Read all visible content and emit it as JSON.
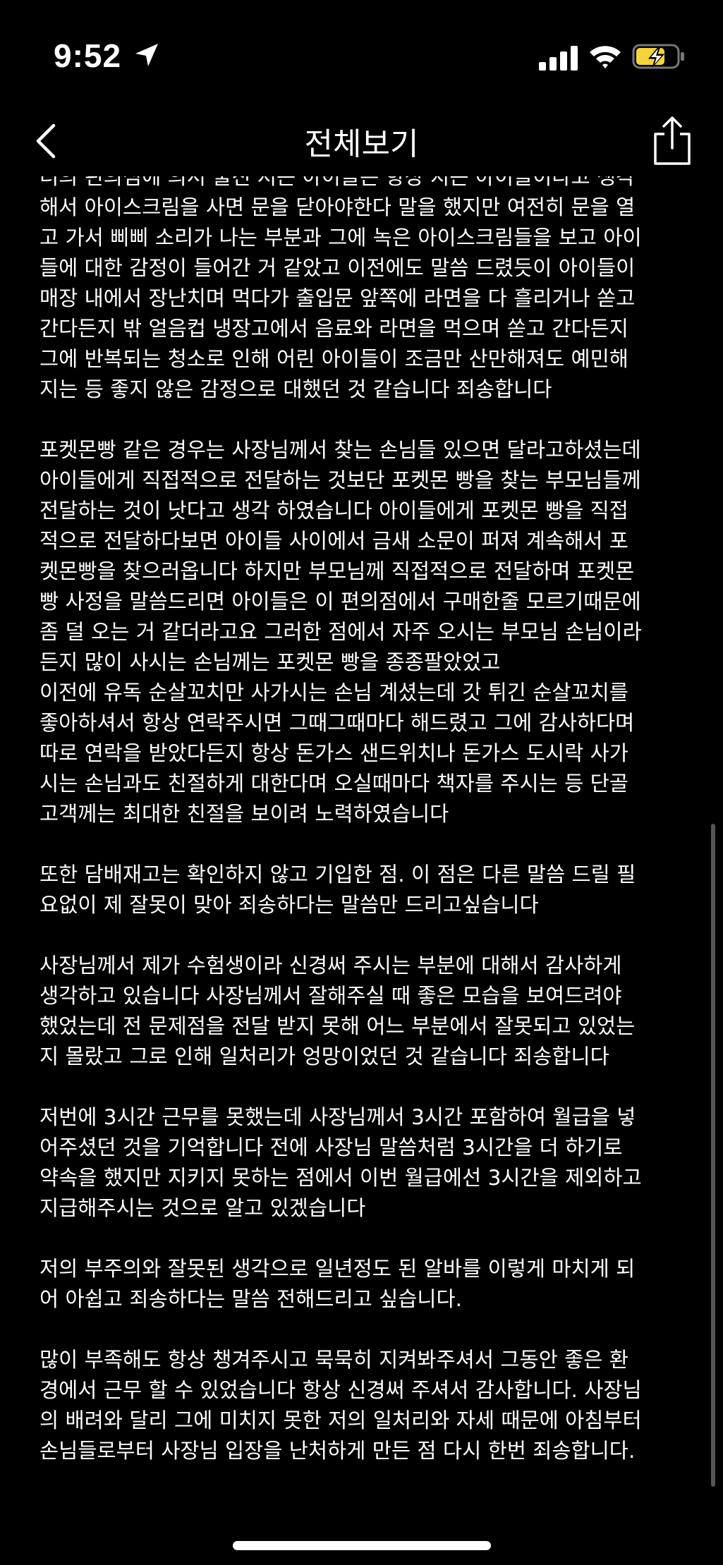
{
  "status_bar": {
    "time": "9:52",
    "icons": [
      "location-arrow-icon",
      "cellular-signal-icon",
      "wifi-icon",
      "battery-charging-icon"
    ],
    "battery_color": "#f5d33b"
  },
  "nav": {
    "title": "전체보기",
    "back_icon": "chevron-left-icon",
    "share_icon": "share-icon"
  },
  "paragraphs": [
    {
      "lines": [
        "더의 핀의심에 의서 물진 저는 아이들은 항상 지는 아이들이다고 생각",
        "해서 아이스크림을 사면 문을 닫아야한다 말을 했지만 여전히 문을 열",
        "고 가서 삐삐 소리가 나는 부분과 그에 녹은 아이스크림들을 보고 아이",
        "들에 대한 감정이 들어간 거 같았고 이전에도 말씀 드렸듯이 아이들이",
        "매장 내에서 장난치며 먹다가 출입문 앞쪽에 라면을 다 흘리거나 쏟고",
        "간다든지 밖 얼음컵 냉장고에서 음료와 라면을 먹으며 쏟고 간다든지",
        "그에 반복되는 청소로 인해 어린 아이들이 조금만 산만해져도 예민해",
        "지는 등 좋지 않은 감정으로 대했던 것 같습니다 죄송합니다"
      ]
    },
    {
      "lines": [
        "포켓몬빵 같은 경우는 사장님께서 찾는 손님들 있으면 달라고하셨는데",
        "아이들에게 직접적으로 전달하는 것보단 포켓몬 빵을 찾는 부모님들께",
        "전달하는 것이 낫다고 생각 하였습니다 아이들에게 포켓몬 빵을 직접",
        "적으로 전달하다보면 아이들 사이에서 금새 소문이 퍼져 계속해서 포",
        "켓몬빵을 찾으러옵니다 하지만 부모님께 직접적으로 전달하며 포켓몬",
        "빵 사정을 말씀드리면 아이들은 이 편의점에서 구매한줄 모르기때문에",
        "좀 덜 오는 거 같더라고요 그러한 점에서 자주 오시는 부모님 손님이라",
        "든지 많이 사시는 손님께는 포켓몬 빵을 종종팔았었고",
        "이전에 유독 순살꼬치만 사가시는 손님 계셨는데  갓 튀긴 순살꼬치를",
        "좋아하셔서 항상 연락주시면 그때그때마다 해드렸고 그에 감사하다며",
        "따로 연락을 받았다든지 항상 돈가스 샌드위치나 돈가스 도시락 사가",
        "시는 손님과도 친절하게 대한다며 오실때마다 책자를 주시는 등 단골",
        "고객께는 최대한 친절을 보이려 노력하였습니다"
      ]
    },
    {
      "lines": [
        "또한 담배재고는 확인하지 않고 기입한 점. 이 점은 다른 말씀 드릴 필",
        "요없이 제 잘못이 맞아 죄송하다는 말씀만 드리고싶습니다"
      ]
    },
    {
      "lines": [
        "사장님께서 제가 수험생이라 신경써 주시는 부분에 대해서 감사하게",
        "생각하고 있습니다 사장님께서 잘해주실 때 좋은 모습을 보여드려야",
        "했었는데 전 문제점을 전달 받지 못해 어느 부분에서 잘못되고 있었는",
        "지 몰랐고 그로 인해 일처리가 엉망이었던 것 같습니다 죄송합니다"
      ]
    },
    {
      "lines": [
        "저번에 3시간 근무를 못했는데 사장님께서 3시간 포함하여 월급을 넣",
        "어주셨던 것을 기억합니다 전에 사장님 말씀처럼 3시간을 더 하기로",
        "약속을 했지만 지키지 못하는 점에서 이번 월급에선 3시간을 제외하고",
        "지급해주시는 것으로 알고 있겠습니다"
      ]
    },
    {
      "lines": [
        "저의 부주의와 잘못된 생각으로 일년정도 된 알바를 이렇게 마치게 되",
        "어 아쉽고 죄송하다는 말씀 전해드리고 싶습니다."
      ]
    },
    {
      "lines": [
        "많이 부족해도 항상 챙겨주시고 묵묵히 지켜봐주셔서 그동안 좋은 환",
        "경에서 근무 할 수 있었습니다 항상 신경써 주셔서 감사합니다. 사장님",
        "의 배려와 달리 그에 미치지 못한 저의 일처리와 자세 때문에 아침부터",
        "손님들로부터 사장님 입장을 난처하게 만든 점 다시 한번 죄송합니다."
      ]
    }
  ]
}
